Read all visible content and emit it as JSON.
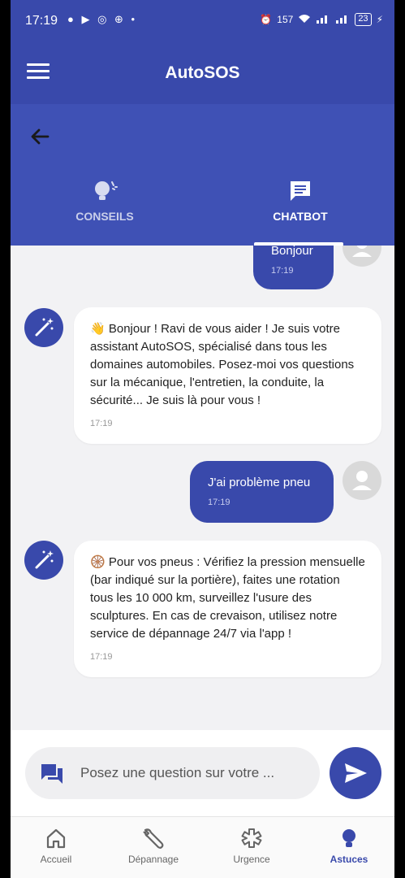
{
  "status_bar": {
    "time": "17:19",
    "network_speed": "157",
    "battery": "23"
  },
  "app_bar": {
    "title": "AutoSOS"
  },
  "tabs": [
    {
      "label": "CONSEILS",
      "active": false
    },
    {
      "label": "CHATBOT",
      "active": true
    }
  ],
  "messages": [
    {
      "sender": "user",
      "text": "Bonjour",
      "time": "17:19"
    },
    {
      "sender": "bot",
      "emoji": "👋",
      "text": "Bonjour ! Ravi de vous aider ! Je suis votre assistant AutoSOS, spécialisé dans tous les domaines automobiles. Posez-moi vos questions sur la mécanique, l'entretien, la conduite, la sécurité... Je suis là pour vous !",
      "time": "17:19"
    },
    {
      "sender": "user",
      "text": "J'ai problème pneu",
      "time": "17:19"
    },
    {
      "sender": "bot",
      "emoji": "🛞",
      "text": "Pour vos pneus : Vérifiez la pression mensuelle (bar indiqué sur la portière), faites une rotation tous les 10 000 km, surveillez l'usure des sculptures. En cas de crevaison, utilisez notre service de dépannage 24/7 via l'app !",
      "time": "17:19"
    }
  ],
  "input": {
    "placeholder": "Posez une question sur votre ..."
  },
  "bottom_nav": [
    {
      "label": "Accueil",
      "icon": "home-icon",
      "active": false
    },
    {
      "label": "Dépannage",
      "icon": "wrench-icon",
      "active": false
    },
    {
      "label": "Urgence",
      "icon": "medical-icon",
      "active": false
    },
    {
      "label": "Astuces",
      "icon": "lightbulb-icon",
      "active": true
    }
  ],
  "colors": {
    "primary": "#3949ab",
    "header": "#3f51b5",
    "background": "#f2f2f4"
  }
}
